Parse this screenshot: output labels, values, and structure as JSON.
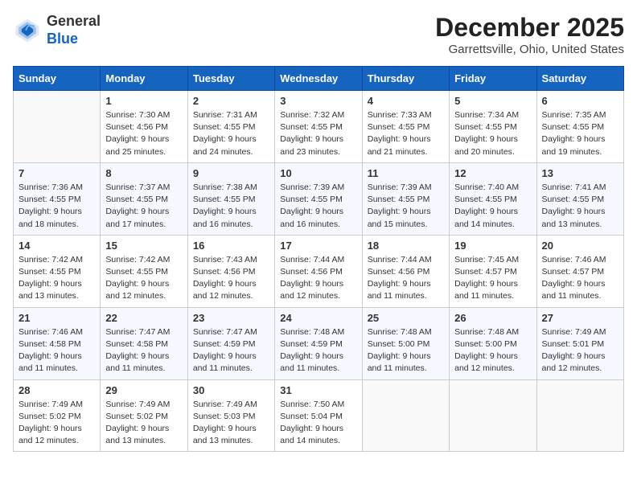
{
  "header": {
    "logo": {
      "line1": "General",
      "line2": "Blue"
    },
    "title": "December 2025",
    "location": "Garrettsville, Ohio, United States"
  },
  "weekdays": [
    "Sunday",
    "Monday",
    "Tuesday",
    "Wednesday",
    "Thursday",
    "Friday",
    "Saturday"
  ],
  "weeks": [
    [
      {
        "day": "",
        "sunrise": "",
        "sunset": "",
        "daylight": ""
      },
      {
        "day": "1",
        "sunrise": "Sunrise: 7:30 AM",
        "sunset": "Sunset: 4:56 PM",
        "daylight": "Daylight: 9 hours and 25 minutes."
      },
      {
        "day": "2",
        "sunrise": "Sunrise: 7:31 AM",
        "sunset": "Sunset: 4:55 PM",
        "daylight": "Daylight: 9 hours and 24 minutes."
      },
      {
        "day": "3",
        "sunrise": "Sunrise: 7:32 AM",
        "sunset": "Sunset: 4:55 PM",
        "daylight": "Daylight: 9 hours and 23 minutes."
      },
      {
        "day": "4",
        "sunrise": "Sunrise: 7:33 AM",
        "sunset": "Sunset: 4:55 PM",
        "daylight": "Daylight: 9 hours and 21 minutes."
      },
      {
        "day": "5",
        "sunrise": "Sunrise: 7:34 AM",
        "sunset": "Sunset: 4:55 PM",
        "daylight": "Daylight: 9 hours and 20 minutes."
      },
      {
        "day": "6",
        "sunrise": "Sunrise: 7:35 AM",
        "sunset": "Sunset: 4:55 PM",
        "daylight": "Daylight: 9 hours and 19 minutes."
      }
    ],
    [
      {
        "day": "7",
        "sunrise": "Sunrise: 7:36 AM",
        "sunset": "Sunset: 4:55 PM",
        "daylight": "Daylight: 9 hours and 18 minutes."
      },
      {
        "day": "8",
        "sunrise": "Sunrise: 7:37 AM",
        "sunset": "Sunset: 4:55 PM",
        "daylight": "Daylight: 9 hours and 17 minutes."
      },
      {
        "day": "9",
        "sunrise": "Sunrise: 7:38 AM",
        "sunset": "Sunset: 4:55 PM",
        "daylight": "Daylight: 9 hours and 16 minutes."
      },
      {
        "day": "10",
        "sunrise": "Sunrise: 7:39 AM",
        "sunset": "Sunset: 4:55 PM",
        "daylight": "Daylight: 9 hours and 16 minutes."
      },
      {
        "day": "11",
        "sunrise": "Sunrise: 7:39 AM",
        "sunset": "Sunset: 4:55 PM",
        "daylight": "Daylight: 9 hours and 15 minutes."
      },
      {
        "day": "12",
        "sunrise": "Sunrise: 7:40 AM",
        "sunset": "Sunset: 4:55 PM",
        "daylight": "Daylight: 9 hours and 14 minutes."
      },
      {
        "day": "13",
        "sunrise": "Sunrise: 7:41 AM",
        "sunset": "Sunset: 4:55 PM",
        "daylight": "Daylight: 9 hours and 13 minutes."
      }
    ],
    [
      {
        "day": "14",
        "sunrise": "Sunrise: 7:42 AM",
        "sunset": "Sunset: 4:55 PM",
        "daylight": "Daylight: 9 hours and 13 minutes."
      },
      {
        "day": "15",
        "sunrise": "Sunrise: 7:42 AM",
        "sunset": "Sunset: 4:55 PM",
        "daylight": "Daylight: 9 hours and 12 minutes."
      },
      {
        "day": "16",
        "sunrise": "Sunrise: 7:43 AM",
        "sunset": "Sunset: 4:56 PM",
        "daylight": "Daylight: 9 hours and 12 minutes."
      },
      {
        "day": "17",
        "sunrise": "Sunrise: 7:44 AM",
        "sunset": "Sunset: 4:56 PM",
        "daylight": "Daylight: 9 hours and 12 minutes."
      },
      {
        "day": "18",
        "sunrise": "Sunrise: 7:44 AM",
        "sunset": "Sunset: 4:56 PM",
        "daylight": "Daylight: 9 hours and 11 minutes."
      },
      {
        "day": "19",
        "sunrise": "Sunrise: 7:45 AM",
        "sunset": "Sunset: 4:57 PM",
        "daylight": "Daylight: 9 hours and 11 minutes."
      },
      {
        "day": "20",
        "sunrise": "Sunrise: 7:46 AM",
        "sunset": "Sunset: 4:57 PM",
        "daylight": "Daylight: 9 hours and 11 minutes."
      }
    ],
    [
      {
        "day": "21",
        "sunrise": "Sunrise: 7:46 AM",
        "sunset": "Sunset: 4:58 PM",
        "daylight": "Daylight: 9 hours and 11 minutes."
      },
      {
        "day": "22",
        "sunrise": "Sunrise: 7:47 AM",
        "sunset": "Sunset: 4:58 PM",
        "daylight": "Daylight: 9 hours and 11 minutes."
      },
      {
        "day": "23",
        "sunrise": "Sunrise: 7:47 AM",
        "sunset": "Sunset: 4:59 PM",
        "daylight": "Daylight: 9 hours and 11 minutes."
      },
      {
        "day": "24",
        "sunrise": "Sunrise: 7:48 AM",
        "sunset": "Sunset: 4:59 PM",
        "daylight": "Daylight: 9 hours and 11 minutes."
      },
      {
        "day": "25",
        "sunrise": "Sunrise: 7:48 AM",
        "sunset": "Sunset: 5:00 PM",
        "daylight": "Daylight: 9 hours and 11 minutes."
      },
      {
        "day": "26",
        "sunrise": "Sunrise: 7:48 AM",
        "sunset": "Sunset: 5:00 PM",
        "daylight": "Daylight: 9 hours and 12 minutes."
      },
      {
        "day": "27",
        "sunrise": "Sunrise: 7:49 AM",
        "sunset": "Sunset: 5:01 PM",
        "daylight": "Daylight: 9 hours and 12 minutes."
      }
    ],
    [
      {
        "day": "28",
        "sunrise": "Sunrise: 7:49 AM",
        "sunset": "Sunset: 5:02 PM",
        "daylight": "Daylight: 9 hours and 12 minutes."
      },
      {
        "day": "29",
        "sunrise": "Sunrise: 7:49 AM",
        "sunset": "Sunset: 5:02 PM",
        "daylight": "Daylight: 9 hours and 13 minutes."
      },
      {
        "day": "30",
        "sunrise": "Sunrise: 7:49 AM",
        "sunset": "Sunset: 5:03 PM",
        "daylight": "Daylight: 9 hours and 13 minutes."
      },
      {
        "day": "31",
        "sunrise": "Sunrise: 7:50 AM",
        "sunset": "Sunset: 5:04 PM",
        "daylight": "Daylight: 9 hours and 14 minutes."
      },
      {
        "day": "",
        "sunrise": "",
        "sunset": "",
        "daylight": ""
      },
      {
        "day": "",
        "sunrise": "",
        "sunset": "",
        "daylight": ""
      },
      {
        "day": "",
        "sunrise": "",
        "sunset": "",
        "daylight": ""
      }
    ]
  ]
}
